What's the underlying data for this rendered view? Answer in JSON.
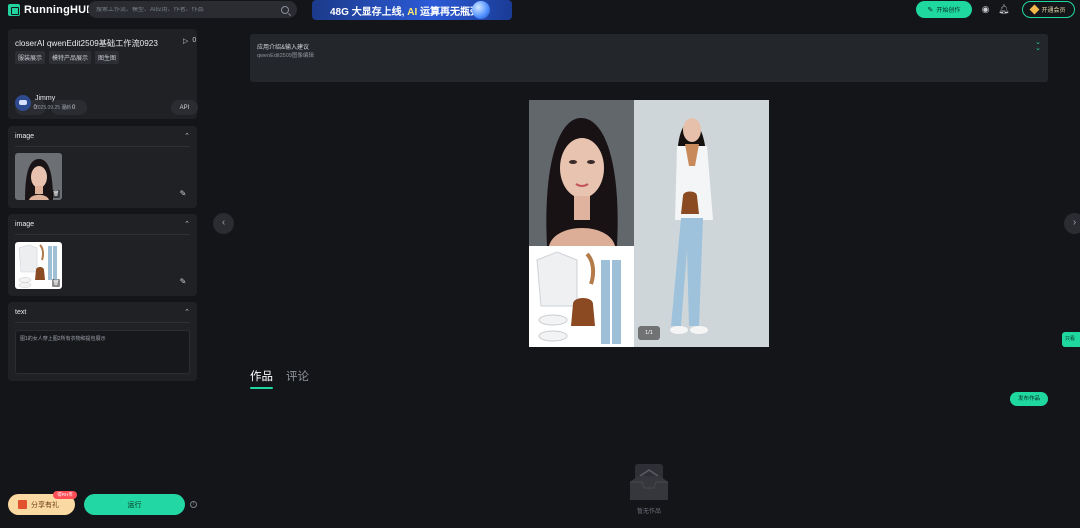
{
  "header": {
    "logo_text": "RunningHUB",
    "search_placeholder": "搜索工作流、模型、AI应用、作者、作品",
    "banner_prefix": "48G",
    "banner_mid": "大显存上线,",
    "banner_ai": "AI",
    "banner_suffix": "运算再无瓶颈",
    "create_label": "开始创作",
    "member_label": "开通会员",
    "accent_color": "#1fd8a0"
  },
  "workflow": {
    "title": "closerAI qwenEdit2509基础工作流0923",
    "run_count": "0",
    "tags": [
      "服装展示",
      "模特产品展示",
      "图生图"
    ],
    "likes": "0",
    "favorites": "0",
    "api_label": "API",
    "author_name": "Jimmy",
    "author_date": "2025.09.25 更新"
  },
  "inputs": [
    {
      "header": "image"
    },
    {
      "header": "image"
    },
    {
      "header": "text",
      "value": "图1的女人穿上图2所有衣物和提包展示"
    }
  ],
  "actions": {
    "share_label": "分享有礼",
    "share_badge": "得RH币",
    "run_label": "运行",
    "info_icon": "i"
  },
  "description": {
    "title": "应用介绍&输入建议",
    "subtitle": "qwenEdit2509图像编辑"
  },
  "preview": {
    "counter": "1/1"
  },
  "content_tabs": [
    {
      "label": "作品",
      "active": true
    },
    {
      "label": "评论",
      "active": false
    }
  ],
  "publish_label": "发布作品",
  "empty_text": "暂无作品",
  "side_tab_label": "只看"
}
